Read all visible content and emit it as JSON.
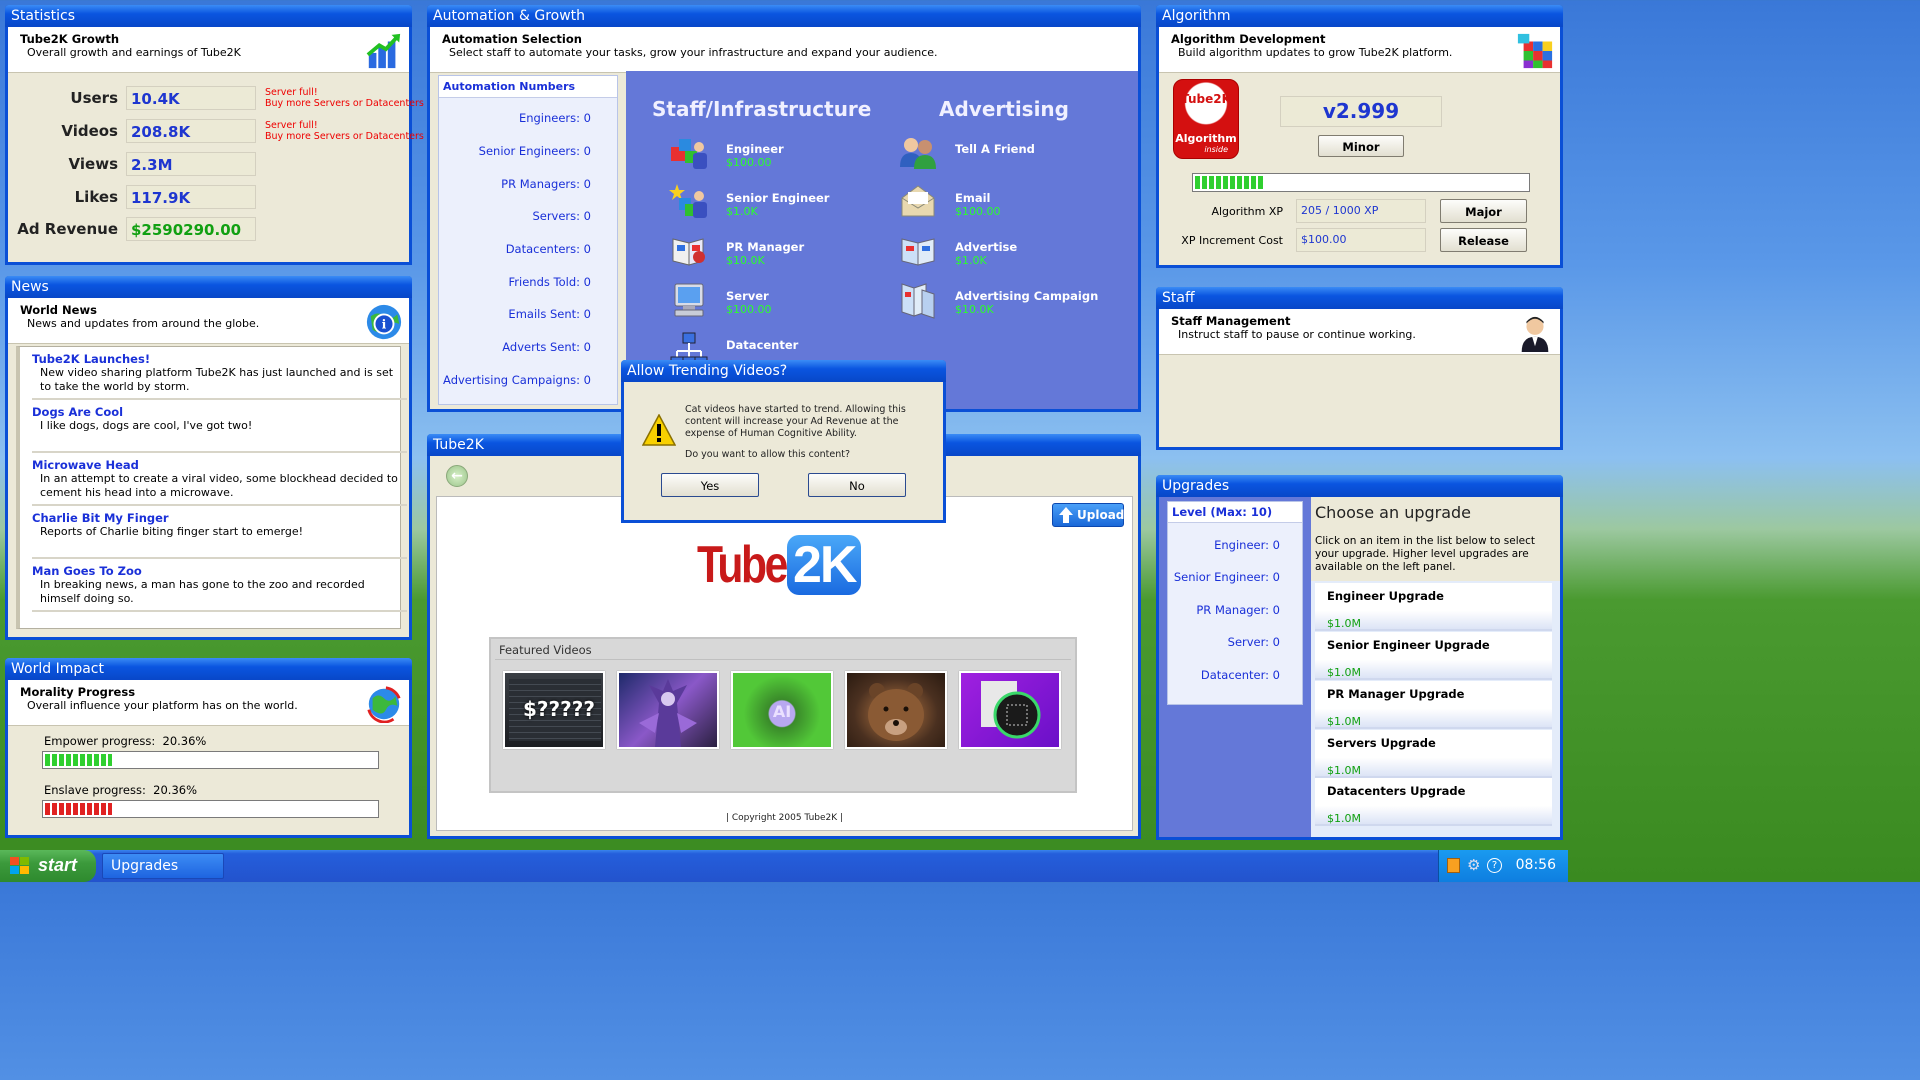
{
  "statistics": {
    "title": "Statistics",
    "header": "Tube2K Growth",
    "sub": "Overall growth and earnings of Tube2K",
    "rows": [
      {
        "label": "Users",
        "value": "10.4K",
        "warn1": "Server full!",
        "warn2": "Buy more Servers or Datacenters"
      },
      {
        "label": "Videos",
        "value": "208.8K",
        "warn1": "Server full!",
        "warn2": "Buy more Servers or Datacenters"
      },
      {
        "label": "Views",
        "value": "2.3M",
        "warn1": "",
        "warn2": ""
      },
      {
        "label": "Likes",
        "value": "117.9K",
        "warn1": "",
        "warn2": ""
      },
      {
        "label": "Ad Revenue",
        "value": "$2590290.00",
        "warn1": "",
        "warn2": ""
      }
    ]
  },
  "news": {
    "title": "News",
    "header": "World News",
    "sub": "News and updates from around the globe.",
    "items": [
      {
        "title": "Tube2K Launches!",
        "body": "New video sharing platform Tube2K has just launched and is set to take the world by storm."
      },
      {
        "title": "Dogs Are Cool",
        "body": "I like dogs, dogs are cool, I've got two!"
      },
      {
        "title": "Microwave Head",
        "body": "In an attempt to create a viral video, some blockhead decided to cement his head into a microwave."
      },
      {
        "title": "Charlie Bit My Finger",
        "body": "Reports of Charlie biting finger start to emerge!"
      },
      {
        "title": "Man Goes To Zoo",
        "body": "In breaking news, a man has gone to the zoo and recorded himself doing so."
      }
    ]
  },
  "impact": {
    "title": "World Impact",
    "header": "Morality Progress",
    "sub": "Overall influence your platform has on the world.",
    "empower_label": "Empower progress:",
    "empower_value": "20.36%",
    "empower_fraction": 0.2036,
    "enslave_label": "Enslave progress:",
    "enslave_value": "20.36%",
    "enslave_fraction": 0.2036
  },
  "automation": {
    "title": "Automation & Growth",
    "header": "Automation Selection",
    "sub": "Select staff to automate your tasks, grow your infrastructure and expand your audience.",
    "numbers_title": "Automation Numbers",
    "numbers": [
      "Engineers: 0",
      "Senior Engineers: 0",
      "PR Managers: 0",
      "Servers: 0",
      "Datacenters: 0",
      "Friends Told: 0",
      "Emails Sent: 0",
      "Adverts Sent: 0",
      "Advertising Campaigns: 0"
    ],
    "staff_heading": "Staff/Infrastructure",
    "ad_heading": "Advertising",
    "staff": [
      {
        "name": "Engineer",
        "cost": "$100.00"
      },
      {
        "name": "Senior Engineer",
        "cost": "$1.0K"
      },
      {
        "name": "PR Manager",
        "cost": "$10.0K"
      },
      {
        "name": "Server",
        "cost": "$100.00"
      },
      {
        "name": "Datacenter",
        "cost": ""
      }
    ],
    "ads": [
      {
        "name": "Tell A Friend",
        "cost": ""
      },
      {
        "name": "Email",
        "cost": "$100.00"
      },
      {
        "name": "Advertise",
        "cost": "$1.0K"
      },
      {
        "name": "Advertising Campaign",
        "cost": "$10.0K"
      }
    ]
  },
  "tube": {
    "title": "Tube2K",
    "upload": "Upload",
    "logo_left": "Tube",
    "logo_right": "2K",
    "featured": "Featured Videos",
    "thumb1": "$?????",
    "thumb3": "AI",
    "copyright": "| Copyright 2005 Tube2K |"
  },
  "dialog": {
    "title": "Allow Trending Videos?",
    "body": "Cat videos have started to trend. Allowing this content will increase your Ad Revenue at the expense of Human Cognitive Ability.",
    "question": "Do you want to allow this content?",
    "yes": "Yes",
    "no": "No"
  },
  "algorithm": {
    "title": "Algorithm",
    "header": "Algorithm Development",
    "sub": "Build algorithm updates to grow Tube2K platform.",
    "logo_top": "Tube2K",
    "logo_mid": "Algorithm",
    "logo_bot": "inside",
    "version": "v2.999",
    "minor": "Minor",
    "major": "Major",
    "release": "Release",
    "progress_fraction": 0.205,
    "xp_label": "Algorithm XP",
    "xp_value": "205 / 1000 XP",
    "cost_label": "XP Increment Cost",
    "cost_value": "$100.00"
  },
  "staffpanel": {
    "title": "Staff",
    "header": "Staff Management",
    "sub": "Instruct staff to pause or continue working."
  },
  "upgrades": {
    "title": "Upgrades",
    "level": "Level (Max: 10)",
    "levels": [
      "Engineer: 0",
      "Senior Engineer: 0",
      "PR Manager: 0",
      "Server: 0",
      "Datacenter: 0"
    ],
    "choose": "Choose an upgrade",
    "desc": "Click on an item in the list below to select your upgrade. Higher level upgrades are available on the left panel.",
    "items": [
      {
        "name": "Engineer Upgrade",
        "cost": "$1.0M"
      },
      {
        "name": "Senior Engineer Upgrade",
        "cost": "$1.0M"
      },
      {
        "name": "PR Manager Upgrade",
        "cost": "$1.0M"
      },
      {
        "name": "Servers Upgrade",
        "cost": "$1.0M"
      },
      {
        "name": "Datacenters Upgrade",
        "cost": "$1.0M"
      }
    ]
  },
  "taskbar": {
    "start": "start",
    "task": "Upgrades",
    "time": "08:56"
  },
  "colors": {
    "xp_blue": "#0a4fd6",
    "taskbar": "#245edb",
    "start_green": "#3c9a3c",
    "link_blue": "#1a30d8",
    "money_green": "#2aff2a",
    "warn_red": "#e00000"
  }
}
